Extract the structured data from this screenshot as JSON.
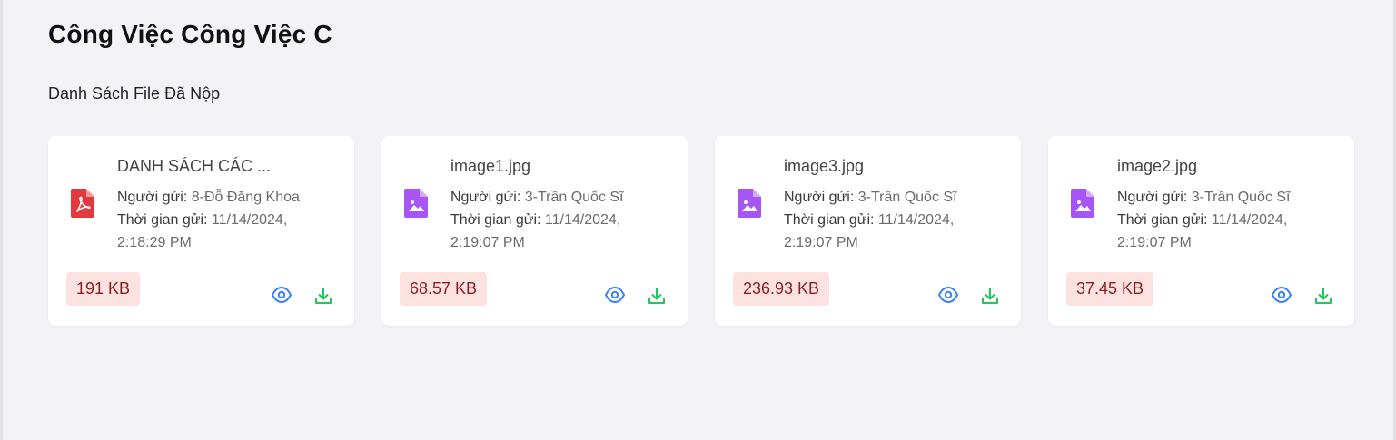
{
  "page_title": "Công Việc Công Việc C",
  "section_title": "Danh Sách File Đã Nộp",
  "labels": {
    "sender": "Người gửi:",
    "time": "Thời gian gửi:"
  },
  "colors": {
    "pdf_icon": "#e0393e",
    "image_icon": "#a855f7",
    "view_icon": "#3b82f6",
    "download_icon": "#22c55e",
    "size_badge_bg": "#fde2e2",
    "size_badge_text": "#8b1e1e"
  },
  "files": [
    {
      "name": "DANH SÁCH CÁC ...",
      "icon": "pdf-file-icon",
      "sender": "8-Đỗ Đăng Khoa",
      "time": "11/14/2024,",
      "time2": "2:18:29 PM",
      "size": "191 KB"
    },
    {
      "name": "image1.jpg",
      "icon": "image-file-icon",
      "sender": "3-Trần Quốc Sĩ",
      "time": "11/14/2024,",
      "time2": "2:19:07 PM",
      "size": "68.57 KB"
    },
    {
      "name": "image3.jpg",
      "icon": "image-file-icon",
      "sender": "3-Trần Quốc Sĩ",
      "time": "11/14/2024,",
      "time2": "2:19:07 PM",
      "size": "236.93 KB"
    },
    {
      "name": "image2.jpg",
      "icon": "image-file-icon",
      "sender": "3-Trần Quốc Sĩ",
      "time": "11/14/2024,",
      "time2": "2:19:07 PM",
      "size": "37.45 KB"
    }
  ]
}
